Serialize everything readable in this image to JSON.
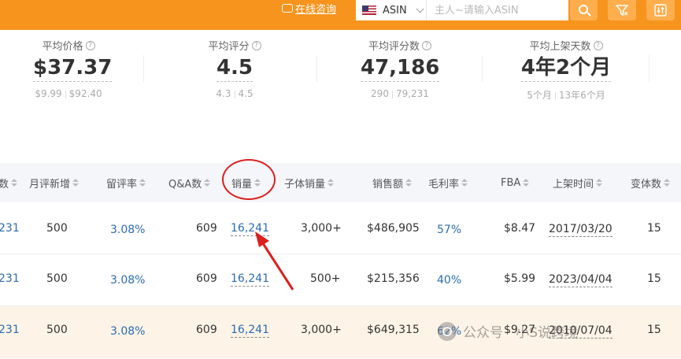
{
  "header": {
    "consult_label": "在线咨询",
    "country_code": "ASIN",
    "search_placeholder": "主人~请输入ASIN",
    "accent_color": "#f7941d"
  },
  "stats": [
    {
      "label": "平均价格",
      "value": "$37.37",
      "min": "$9.99",
      "max": "$92.40"
    },
    {
      "label": "平均评分",
      "value": "4.5",
      "min": "4.3",
      "max": "4.5"
    },
    {
      "label": "平均评分数",
      "value": "47,186",
      "min": "290",
      "max": "79,231"
    },
    {
      "label": "平均上架天数",
      "value": "4年2个月",
      "min": "5个月",
      "max": "13年6个月"
    }
  ],
  "table": {
    "columns": [
      "数",
      "月评新增",
      "留评率",
      "Q&A数",
      "销量",
      "子体销量",
      "销售额",
      "毛利率",
      "FBA",
      "上架时间",
      "变体数"
    ],
    "rows": [
      {
        "reviews": "231",
        "monthly_new": "500",
        "review_rate": "3.08%",
        "qa": "609",
        "sales": "16,241",
        "child_sales": "3,000+",
        "revenue": "$486,905",
        "margin": "57%",
        "fba": "$8.47",
        "listed": "2017/03/20",
        "variants": "15"
      },
      {
        "reviews": "231",
        "monthly_new": "500",
        "review_rate": "3.08%",
        "qa": "609",
        "sales": "16,241",
        "child_sales": "500+",
        "revenue": "$215,356",
        "margin": "40%",
        "fba": "$5.99",
        "listed": "2023/04/04",
        "variants": "15"
      },
      {
        "reviews": "231",
        "monthly_new": "500",
        "review_rate": "3.08%",
        "qa": "609",
        "sales": "16,241",
        "child_sales": "3,000+",
        "revenue": "$649,315",
        "margin": "62%",
        "fba": "$9.27",
        "listed": "2010/07/04",
        "variants": "15"
      }
    ]
  },
  "watermark": {
    "text": "公众号 · 小S说跨境"
  }
}
